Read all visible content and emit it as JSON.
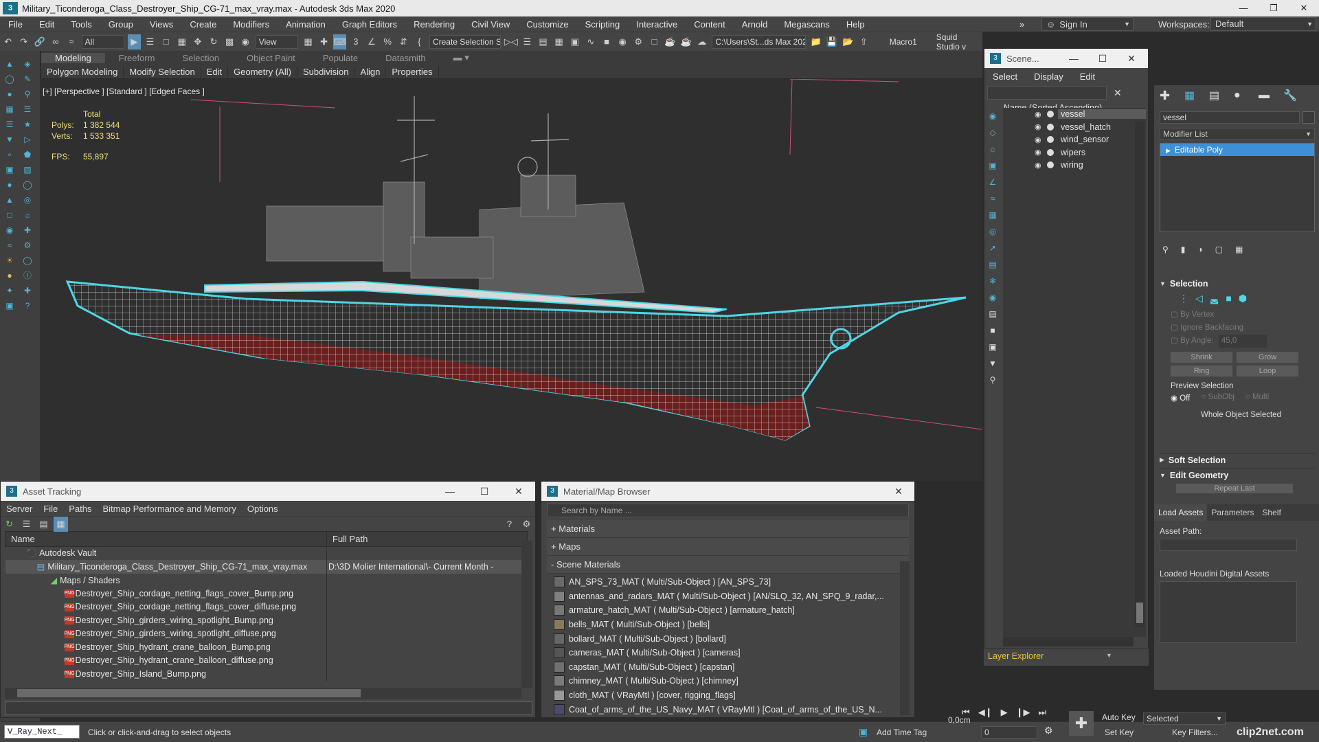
{
  "window": {
    "title": "Military_Ticonderoga_Class_Destroyer_Ship_CG-71_max_vray.max - Autodesk 3ds Max 2020",
    "app_icon": "3"
  },
  "menu": [
    "File",
    "Edit",
    "Tools",
    "Group",
    "Views",
    "Create",
    "Modifiers",
    "Animation",
    "Graph Editors",
    "Rendering",
    "Civil View",
    "Customize",
    "Scripting",
    "Interactive",
    "Content",
    "Arnold",
    "Megascans",
    "Help"
  ],
  "signin": "Sign In",
  "workspaces": {
    "label": "Workspaces:",
    "value": "Default"
  },
  "toolbar": {
    "filter": "All",
    "view": "View",
    "selection_set": "Create Selection Se",
    "project_path": "C:\\Users\\St...ds Max 2020",
    "macro": "Macro1",
    "squid": "Squid Studio v"
  },
  "ribbon_tabs": [
    "Modeling",
    "Freeform",
    "Selection",
    "Object Paint",
    "Populate",
    "Datasmith"
  ],
  "ribbon_items": [
    "Polygon Modeling",
    "Modify Selection",
    "Edit",
    "Geometry (All)",
    "Subdivision",
    "Align",
    "Properties"
  ],
  "viewport": {
    "label": "[+] [Perspective ] [Standard ] [Edged Faces ]",
    "stats": {
      "header": "Total",
      "polys_label": "Polys:",
      "polys": "1 382 544",
      "verts_label": "Verts:",
      "verts": "1 533 351",
      "fps_label": "FPS:",
      "fps": "55,897"
    }
  },
  "asset_tracking": {
    "title": "Asset Tracking",
    "menu": [
      "Server",
      "File",
      "Paths",
      "Bitmap Performance and Memory",
      "Options"
    ],
    "columns": [
      "Name",
      "Full Path"
    ],
    "rows": [
      {
        "name": "Autodesk Vault",
        "path": "",
        "indent": 0
      },
      {
        "name": "Military_Ticonderoga_Class_Destroyer_Ship_CG-71_max_vray.max",
        "path": "D:\\3D Molier International\\- Current Month -",
        "indent": 1
      },
      {
        "name": "Maps / Shaders",
        "path": "",
        "indent": 2
      },
      {
        "name": "Destroyer_Ship_cordage_netting_flags_cover_Bump.png",
        "path": "",
        "indent": 3
      },
      {
        "name": "Destroyer_Ship_cordage_netting_flags_cover_diffuse.png",
        "path": "",
        "indent": 3
      },
      {
        "name": "Destroyer_Ship_girders_wiring_spotlight_Bump.png",
        "path": "",
        "indent": 3
      },
      {
        "name": "Destroyer_Ship_girders_wiring_spotlight_diffuse.png",
        "path": "",
        "indent": 3
      },
      {
        "name": "Destroyer_Ship_hydrant_crane_balloon_Bump.png",
        "path": "",
        "indent": 3
      },
      {
        "name": "Destroyer_Ship_hydrant_crane_balloon_diffuse.png",
        "path": "",
        "indent": 3
      },
      {
        "name": "Destroyer_Ship_Island_Bump.png",
        "path": "",
        "indent": 3
      }
    ]
  },
  "material_browser": {
    "title": "Material/Map Browser",
    "search_placeholder": "Search by Name ...",
    "sections": [
      "+ Materials",
      "+ Maps",
      "- Scene Materials"
    ],
    "items": [
      "AN_SPS_73_MAT  ( Multi/Sub-Object )  [AN_SPS_73]",
      "antennas_and_radars_MAT  ( Multi/Sub-Object )  [AN/SLQ_32, AN_SPQ_9_radar,...",
      "armature_hatch_MAT  ( Multi/Sub-Object )  [armature_hatch]",
      "bells_MAT  ( Multi/Sub-Object )  [bells]",
      "bollard_MAT  ( Multi/Sub-Object )  [bollard]",
      "cameras_MAT  ( Multi/Sub-Object )  [cameras]",
      "capstan_MAT  ( Multi/Sub-Object )  [capstan]",
      "chimney_MAT  ( Multi/Sub-Object )  [chimney]",
      "cloth_MAT  ( VRayMtl )  [cover, rigging_flags]",
      "Coat_of_arms_of_the_US_Navy_MAT ( VRayMtl ) [Coat_of_arms_of_the_US_N..."
    ]
  },
  "scene_explorer": {
    "title": "Scene...",
    "menu": [
      "Select",
      "Display",
      "Edit"
    ],
    "column": "Name (Sorted Ascending)",
    "items": [
      "vessel",
      "vessel_hatch",
      "wind_sensor",
      "wipers",
      "wiring"
    ],
    "selected": "vessel",
    "footer": "Layer Explorer"
  },
  "command_panel": {
    "object_name": "vessel",
    "modifier_list": "Modifier List",
    "stack_item": "Editable Poly",
    "selection_title": "Selection",
    "by_vertex": "By Vertex",
    "ignore_backfacing": "Ignore Backfacing",
    "by_angle": "By Angle:",
    "by_angle_value": "45,0",
    "shrink": "Shrink",
    "grow": "Grow",
    "ring": "Ring",
    "loop": "Loop",
    "preview_selection": "Preview Selection",
    "preview_off": "Off",
    "preview_subobj": "SubObj",
    "preview_multi": "Multi",
    "whole_object": "Whole Object Selected",
    "soft_selection": "Soft Selection",
    "edit_geometry": "Edit Geometry",
    "repeat_last": "Repeat Last",
    "tabs": [
      "Load Assets",
      "Parameters",
      "Shelf"
    ],
    "asset_path": "Asset Path:",
    "loaded_houdini": "Loaded Houdini Digital Assets"
  },
  "status": {
    "script_field": "V_Ray_Next_",
    "prompt": "Click or click-and-drag to select objects",
    "add_time_tag": "Add Time Tag",
    "grid": "0,0cm",
    "frame": "0",
    "auto_key": "Auto Key",
    "set_key": "Set Key",
    "key_mode": "Selected",
    "key_filters": "Key Filters...",
    "watermark": "clip2net.com"
  },
  "colors": {
    "accent": "#4fd6e6",
    "hull_red": "#7a2222",
    "stats": "#f0e07a",
    "selection": "#3d8fd6"
  }
}
